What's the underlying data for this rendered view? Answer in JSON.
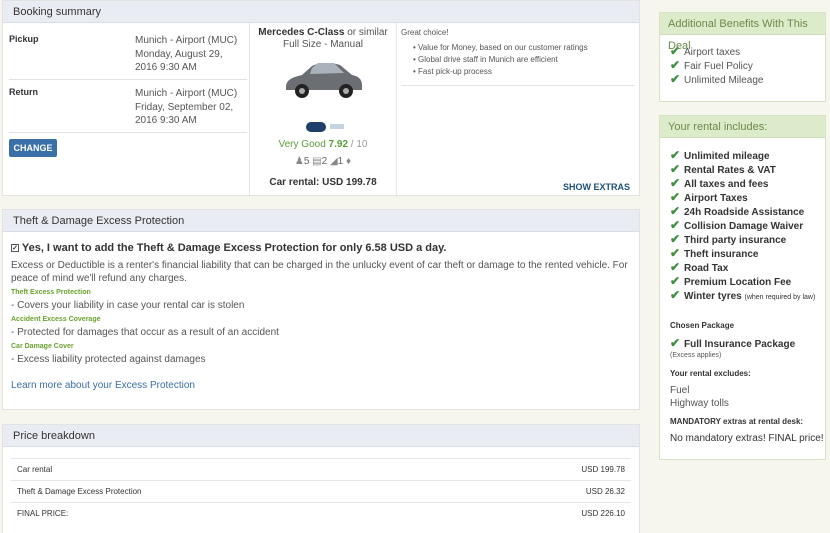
{
  "booking": {
    "title": "Booking summary",
    "pickup_label": "Pickup",
    "pickup_location": "Munich - Airport (MUC)",
    "pickup_date": "Monday, August 29, 2016 9:30 AM",
    "return_label": "Return",
    "return_location": "Munich - Airport (MUC)",
    "return_date": "Friday, September 02, 2016 9:30 AM",
    "change_label": "CHANGE",
    "car_name": "Mercedes C-Class",
    "car_similar": "or similar",
    "car_class": "Full Size - Manual",
    "rating_text": "Very Good",
    "rating_score": "7.92",
    "rating_max": "/ 10",
    "seats": "5",
    "bags": "2",
    "doors": "1",
    "car_rental_label": "Car rental: USD 199.78",
    "great_choice": "Great choice!",
    "benefits": [
      "Value for Money, based on our customer ratings",
      "Global drive staff in Munich are efficient",
      "Fast pick-up process"
    ],
    "show_extras": "SHOW EXTRAS"
  },
  "theft": {
    "title": "Theft & Damage Excess Protection",
    "checkbox_label": "Yes, I want to add the Theft & Damage Excess Protection for only 6.58 USD a day.",
    "description": "Excess or Deductible is a renter's financial liability that can be charged in the unlucky event of car theft or damage to the rented vehicle. For peace of mind we'll refund any charges.",
    "items": [
      {
        "heading": "Theft Excess Protection",
        "text": "- Covers your liability in case your rental car is stolen"
      },
      {
        "heading": "Accident Excess Coverage",
        "text": "- Protected for damages that occur as a result of an accident"
      },
      {
        "heading": "Car Damage Cover",
        "text": "- Excess liability protected against damages"
      }
    ],
    "learn_more": "Learn more about your Excess Protection"
  },
  "price": {
    "title": "Price breakdown",
    "rows": [
      {
        "label": "Car rental",
        "value": "USD 199.78"
      },
      {
        "label": "Theft & Damage Excess Protection",
        "value": "USD 26.32"
      },
      {
        "label": "FINAL PRICE:",
        "value": "USD 226.10"
      }
    ]
  },
  "side_benefits": {
    "title": "Additional Benefits With This Deal",
    "items": [
      "Airport taxes",
      "Fair Fuel Policy",
      "Unlimited Mileage"
    ]
  },
  "includes": {
    "title": "Your rental includes:",
    "items": [
      "Unlimited mileage",
      "Rental Rates & VAT",
      "All taxes and fees",
      "Airport Taxes",
      "24h Roadside Assistance",
      "Collision Damage Waiver",
      "Third party insurance",
      "Theft insurance",
      "Road Tax",
      "Premium Location Fee"
    ],
    "winter_tyres": "Winter tyres",
    "winter_note": "(when required by law)",
    "chosen_label": "Chosen Package",
    "chosen_item": "Full Insurance Package",
    "chosen_note": "(Excess applies)",
    "excludes_label": "Your rental excludes:",
    "excludes": [
      "Fuel",
      "Highway tolls"
    ],
    "mandatory_label": "MANDATORY extras at rental desk:",
    "mandatory_text": "No mandatory extras! FINAL price!"
  },
  "colors": {
    "accent": "#3a6fa8",
    "green": "#3f8f3f",
    "head_bg": "#e9ecf3"
  }
}
